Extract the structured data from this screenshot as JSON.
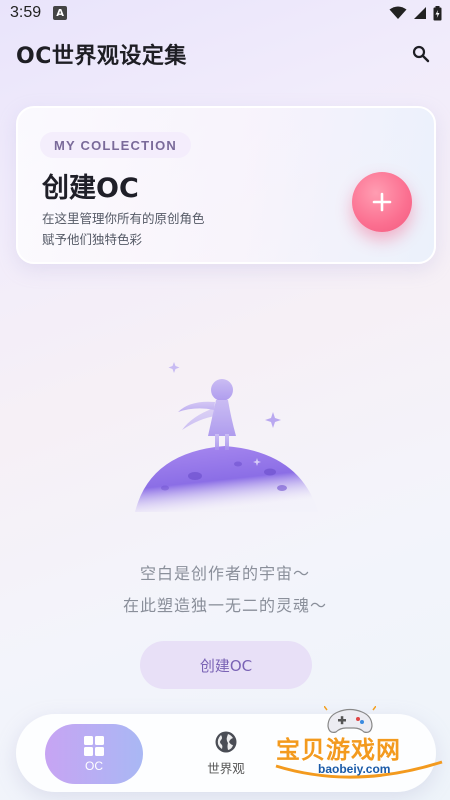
{
  "status_bar": {
    "time": "3:59",
    "notif_letter": "A"
  },
  "header": {
    "title": "OC世界观设定集"
  },
  "card": {
    "badge": "MY COLLECTION",
    "title": "创建OC",
    "desc_line1": "在这里管理你所有的原创角色",
    "desc_line2": "赋予他们独特色彩"
  },
  "empty": {
    "line1": "空白是创作者的宇宙～",
    "line2": "在此塑造独一无二的灵魂～",
    "button_label": "创建OC"
  },
  "tabs": [
    {
      "label": "OC",
      "icon": "grid-icon",
      "active": true
    },
    {
      "label": "世界观",
      "icon": "globe-icon",
      "active": false
    }
  ],
  "watermark": {
    "title": "宝贝游戏网",
    "url": "baobeiy.com"
  },
  "colors": {
    "accent_pink": "#fb6f90",
    "accent_purple": "#c7a4f3",
    "text_muted": "#8a8f9a"
  }
}
